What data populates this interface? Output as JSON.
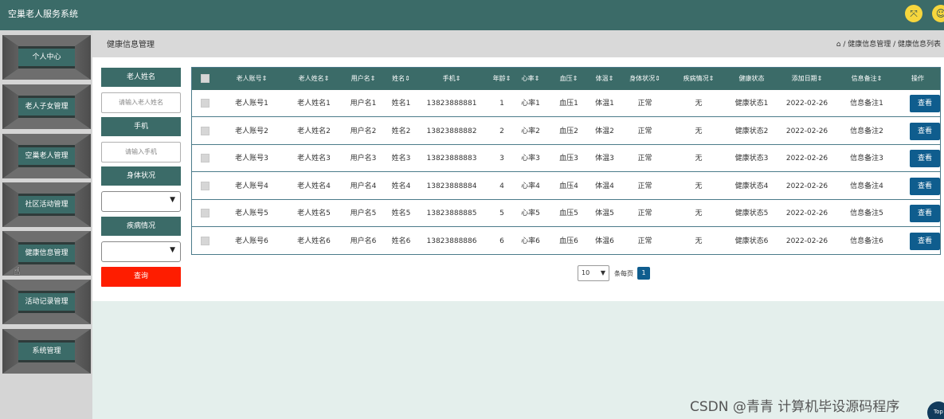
{
  "app": {
    "title": "空巢老人服务系统"
  },
  "header_icons": [
    {
      "name": "expand-icon",
      "glyph": "⤧"
    },
    {
      "name": "user-icon",
      "glyph": "☺"
    }
  ],
  "sidebar": {
    "items": [
      {
        "label": "个人中心"
      },
      {
        "label": "老人子女管理"
      },
      {
        "label": "空巢老人管理"
      },
      {
        "label": "社区活动管理"
      },
      {
        "label": "健康信息管理"
      },
      {
        "label": "活动记录管理"
      },
      {
        "label": "系统管理"
      }
    ]
  },
  "page": {
    "title": "健康信息管理",
    "breadcrumb": "⌂ / 健康信息管理 / 健康信息列表"
  },
  "filters": {
    "name_label": "老人姓名",
    "name_placeholder": "请输入老人姓名",
    "phone_label": "手机",
    "phone_placeholder": "请输入手机",
    "health_label": "身体状况",
    "disease_label": "疾病情况",
    "query_label": "查询"
  },
  "table": {
    "headers": [
      "老人账号⇕",
      "老人姓名⇕",
      "用户名⇕",
      "姓名⇕",
      "手机⇕",
      "年龄⇕",
      "心率⇕",
      "血压⇕",
      "体温⇕",
      "身体状况⇕",
      "疾病情况⇕",
      "健康状态",
      "添加日期⇕",
      "信息备注⇕",
      "操作"
    ],
    "action_label": "查看",
    "rows": [
      [
        "老人账号1",
        "老人姓名1",
        "用户名1",
        "姓名1",
        "13823888881",
        "1",
        "心率1",
        "血压1",
        "体温1",
        "正常",
        "无",
        "健康状态1",
        "2022-02-26",
        "信息备注1"
      ],
      [
        "老人账号2",
        "老人姓名2",
        "用户名2",
        "姓名2",
        "13823888882",
        "2",
        "心率2",
        "血压2",
        "体温2",
        "正常",
        "无",
        "健康状态2",
        "2022-02-26",
        "信息备注2"
      ],
      [
        "老人账号3",
        "老人姓名3",
        "用户名3",
        "姓名3",
        "13823888883",
        "3",
        "心率3",
        "血压3",
        "体温3",
        "正常",
        "无",
        "健康状态3",
        "2022-02-26",
        "信息备注3"
      ],
      [
        "老人账号4",
        "老人姓名4",
        "用户名4",
        "姓名4",
        "13823888884",
        "4",
        "心率4",
        "血压4",
        "体温4",
        "正常",
        "无",
        "健康状态4",
        "2022-02-26",
        "信息备注4"
      ],
      [
        "老人账号5",
        "老人姓名5",
        "用户名5",
        "姓名5",
        "13823888885",
        "5",
        "心率5",
        "血压5",
        "体温5",
        "正常",
        "无",
        "健康状态5",
        "2022-02-26",
        "信息备注5"
      ],
      [
        "老人账号6",
        "老人姓名6",
        "用户名6",
        "姓名6",
        "13823888886",
        "6",
        "心率6",
        "血压6",
        "体温6",
        "正常",
        "无",
        "健康状态6",
        "2022-02-26",
        "信息备注6"
      ]
    ]
  },
  "pagination": {
    "page_size": "10",
    "per_page_label": "条每页",
    "current_page": "1"
  },
  "watermark": "CSDN @青青  计算机毕设源码程序",
  "top_button": "Top",
  "colors": {
    "primary": "#3b6b68",
    "button_blue": "#0f5d8e",
    "query_red": "#fe1d00"
  }
}
